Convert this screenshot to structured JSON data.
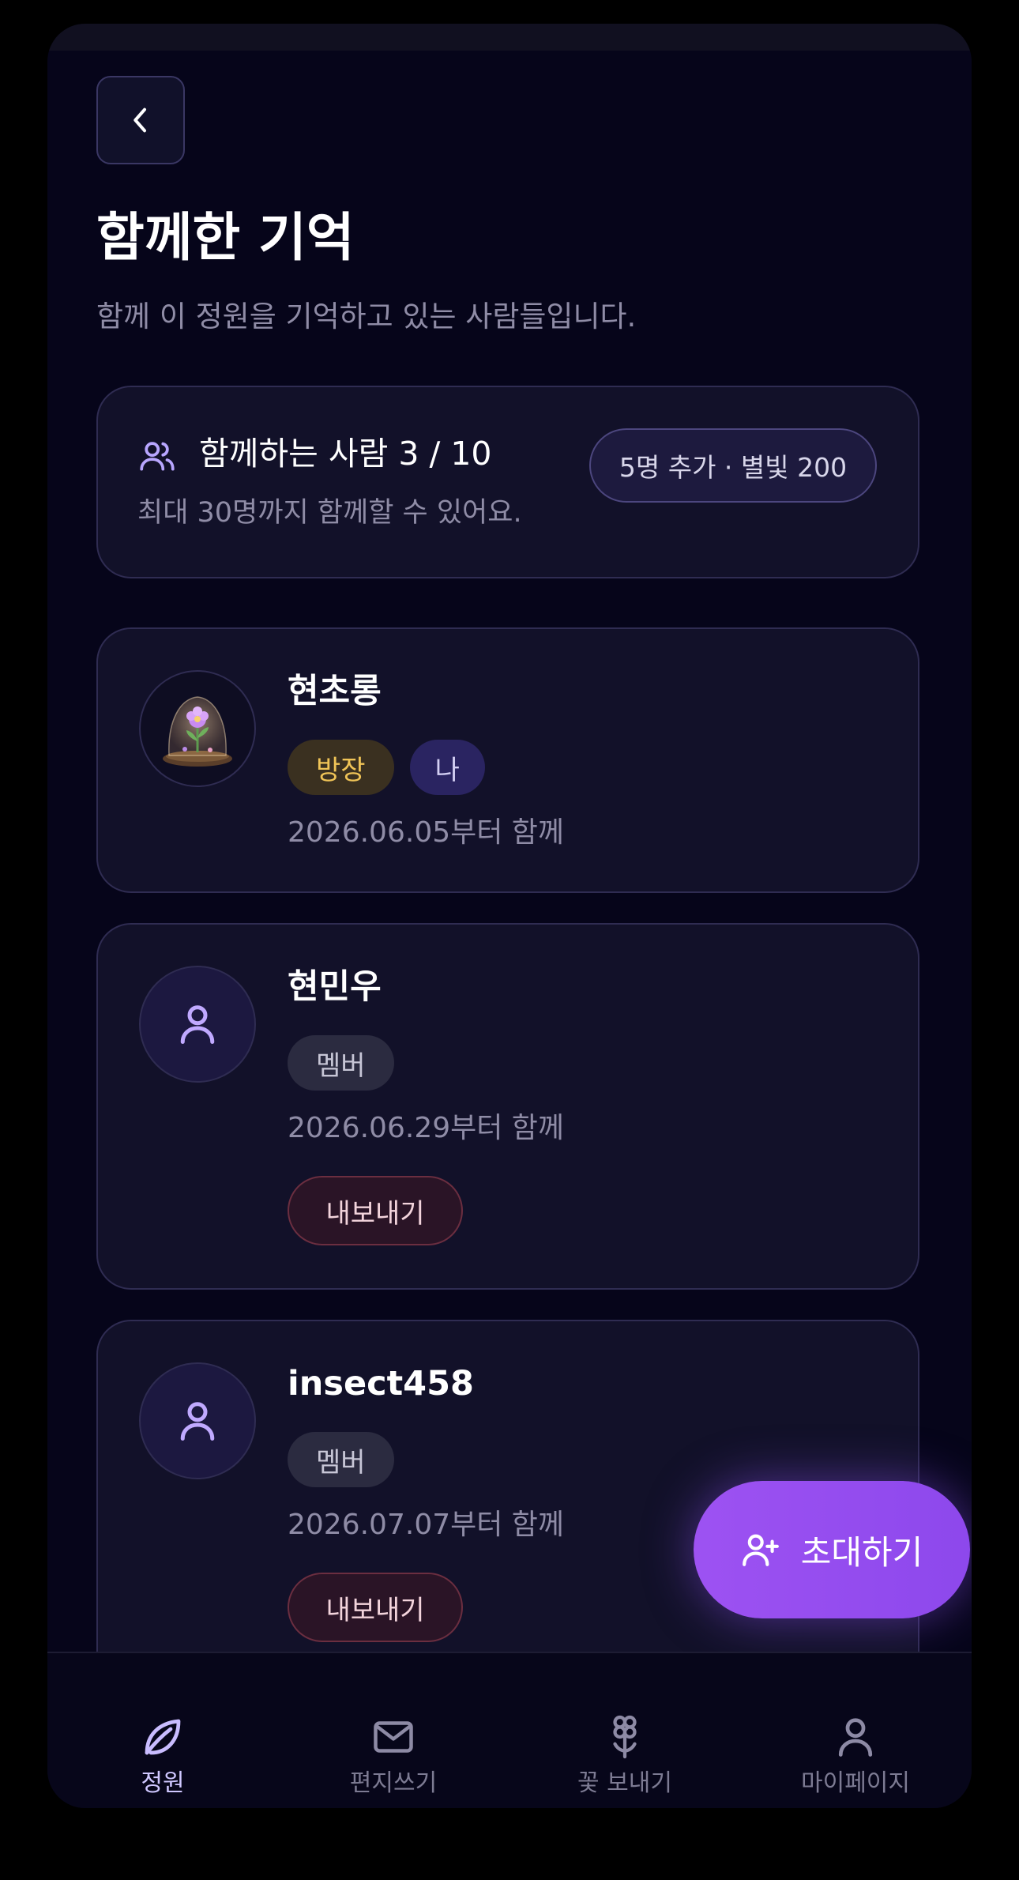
{
  "page": {
    "title": "함께한 기억",
    "subtitle": "함께 이 정원을 기억하고 있는 사람들입니다."
  },
  "summary": {
    "title": "함께하는 사람 3 / 10",
    "description": "최대 30명까지 함께할 수 있어요.",
    "add_button": "5명 추가 · 별빛 200",
    "icon": "users-icon"
  },
  "members": [
    {
      "name": "현초롱",
      "badges": [
        "방장",
        "나"
      ],
      "since": "2026.06.05부터 함께",
      "avatar": "glass-flower-dome"
    },
    {
      "name": "현민우",
      "badges": [
        "멤버"
      ],
      "since": "2026.06.29부터 함께",
      "action": "내보내기",
      "avatar": "user-icon"
    },
    {
      "name": "insect458",
      "badges": [
        "멤버"
      ],
      "since": "2026.07.07부터 함께",
      "action": "내보내기",
      "avatar": "user-icon"
    }
  ],
  "fab": {
    "label": "초대하기",
    "icon": "user-plus-icon"
  },
  "tabbar": [
    {
      "label": "정원",
      "icon": "leaf-icon",
      "active": true
    },
    {
      "label": "편지쓰기",
      "icon": "mail-icon",
      "active": false
    },
    {
      "label": "꽃 보내기",
      "icon": "flower-icon",
      "active": false
    },
    {
      "label": "마이페이지",
      "icon": "user-icon",
      "active": false
    }
  ],
  "colors": {
    "background": "#06051a",
    "card": "#121129",
    "accent": "#9d52f2",
    "owner_badge_text": "#f0c457",
    "kick_border": "#6b2e40"
  }
}
